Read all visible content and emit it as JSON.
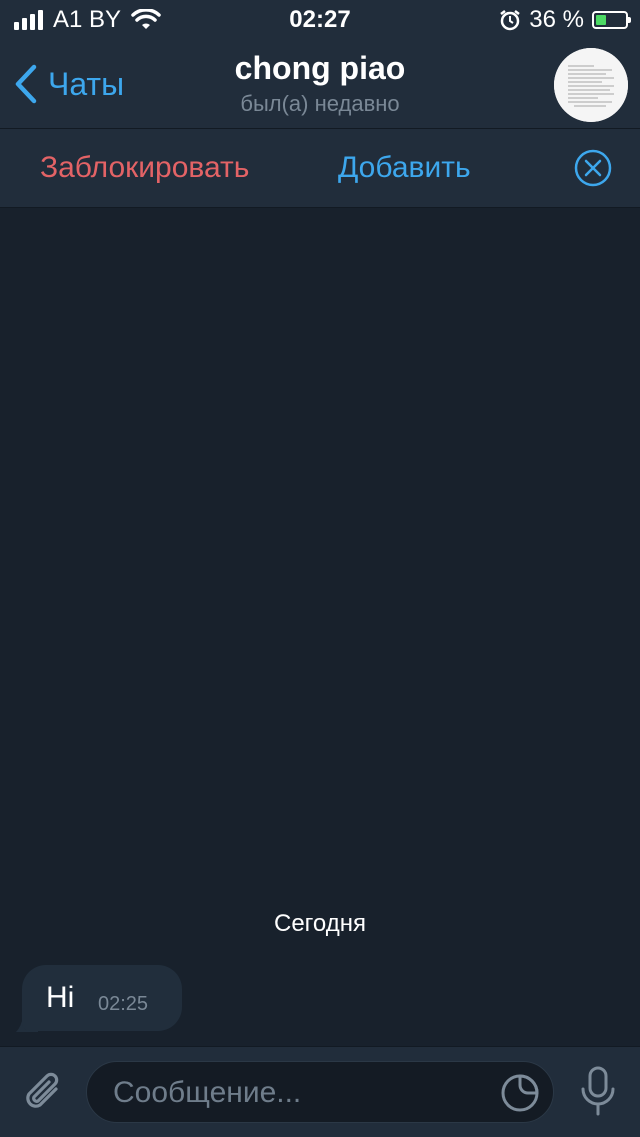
{
  "status_bar": {
    "carrier": "A1 BY",
    "time": "02:27",
    "battery_percent": "36 %",
    "battery_level": 0.36
  },
  "header": {
    "back_label": "Чаты",
    "title": "chong piao",
    "subtitle": "был(а) недавно"
  },
  "actions": {
    "block_label": "Заблокировать",
    "add_label": "Добавить"
  },
  "chat": {
    "date_separator": "Сегодня",
    "messages": [
      {
        "text": "Hi",
        "time": "02:25"
      }
    ]
  },
  "composer": {
    "placeholder": "Сообщение..."
  },
  "colors": {
    "accent": "#3da7ed",
    "danger": "#e36366",
    "background": "#18212c",
    "panel": "#212d3b"
  }
}
